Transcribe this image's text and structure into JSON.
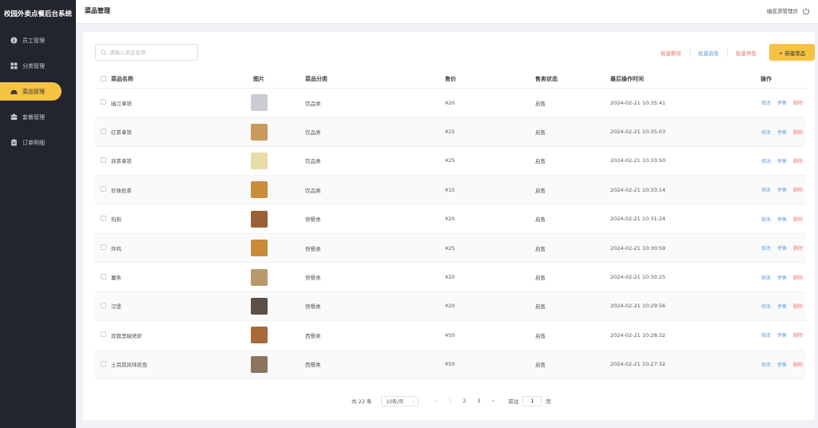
{
  "app": {
    "brand": "校园外卖点餐后台系统"
  },
  "sidebar": {
    "items": [
      {
        "label": "员工管理",
        "icon": "info-icon",
        "active": false
      },
      {
        "label": "分类管理",
        "icon": "grid-icon",
        "active": false
      },
      {
        "label": "菜品管理",
        "icon": "bowl-icon",
        "active": true
      },
      {
        "label": "套餐管理",
        "icon": "box-icon",
        "active": false
      },
      {
        "label": "订单明细",
        "icon": "clipboard-icon",
        "active": false
      }
    ]
  },
  "header": {
    "title": "菜品管理",
    "user": "幽蓝游管理员",
    "power_icon": "power-icon"
  },
  "toolbar": {
    "search_placeholder": "请输入菜品名称",
    "batch_delete": "批量删除",
    "batch_enable": "批量启售",
    "batch_disable": "批量停售",
    "new_dish": "+ 新建菜品"
  },
  "table": {
    "columns": [
      "菜品名称",
      "图片",
      "菜品分类",
      "售价",
      "售卖状态",
      "最后操作时间",
      "操作"
    ],
    "op_labels": {
      "edit": "修改",
      "toggle": "停售",
      "delete": "删除"
    },
    "rows": [
      {
        "name": "幽兰拿铁",
        "category": "饮品类",
        "price": "¥20",
        "status": "启售",
        "time": "2024-02-21 10:35:41",
        "img_color": "#c9ccd2"
      },
      {
        "name": "红茶拿铁",
        "category": "饮品类",
        "price": "¥25",
        "status": "启售",
        "time": "2024-02-21 10:35:03",
        "img_color": "#c89b5d"
      },
      {
        "name": "抹茶拿铁",
        "category": "饮品类",
        "price": "¥25",
        "status": "启售",
        "time": "2024-02-21 10:33:50",
        "img_color": "#e8dca8"
      },
      {
        "name": "珍珠奶茶",
        "category": "饮品类",
        "price": "¥15",
        "status": "启售",
        "time": "2024-02-21 10:33:14",
        "img_color": "#c98e3b"
      },
      {
        "name": "热狗",
        "category": "快餐类",
        "price": "¥20",
        "status": "启售",
        "time": "2024-02-21 10:31:24",
        "img_color": "#9a6236"
      },
      {
        "name": "炸鸡",
        "category": "快餐类",
        "price": "¥25",
        "status": "启售",
        "time": "2024-02-21 10:30:59",
        "img_color": "#c98a3a"
      },
      {
        "name": "薯条",
        "category": "快餐类",
        "price": "¥20",
        "status": "启售",
        "time": "2024-02-21 10:30:25",
        "img_color": "#b89a6a"
      },
      {
        "name": "汉堡",
        "category": "快餐类",
        "price": "¥20",
        "status": "启售",
        "time": "2024-02-21 10:29:56",
        "img_color": "#5a5048"
      },
      {
        "name": "蒜蓉黑椒烤虾",
        "category": "西餐类",
        "price": "¥50",
        "status": "启售",
        "time": "2024-02-21 10:28:32",
        "img_color": "#a86a38"
      },
      {
        "name": "土耳其风味煎鱼",
        "category": "西餐类",
        "price": "¥50",
        "status": "启售",
        "time": "2024-02-21 10:27:32",
        "img_color": "#8a7560"
      }
    ]
  },
  "pagination": {
    "total": "共 22 条",
    "page_size": "10条/页",
    "pages": [
      "1",
      "2",
      "3"
    ],
    "current": "1",
    "goto_label": "前往",
    "goto_value": "1",
    "goto_suffix": "页"
  }
}
